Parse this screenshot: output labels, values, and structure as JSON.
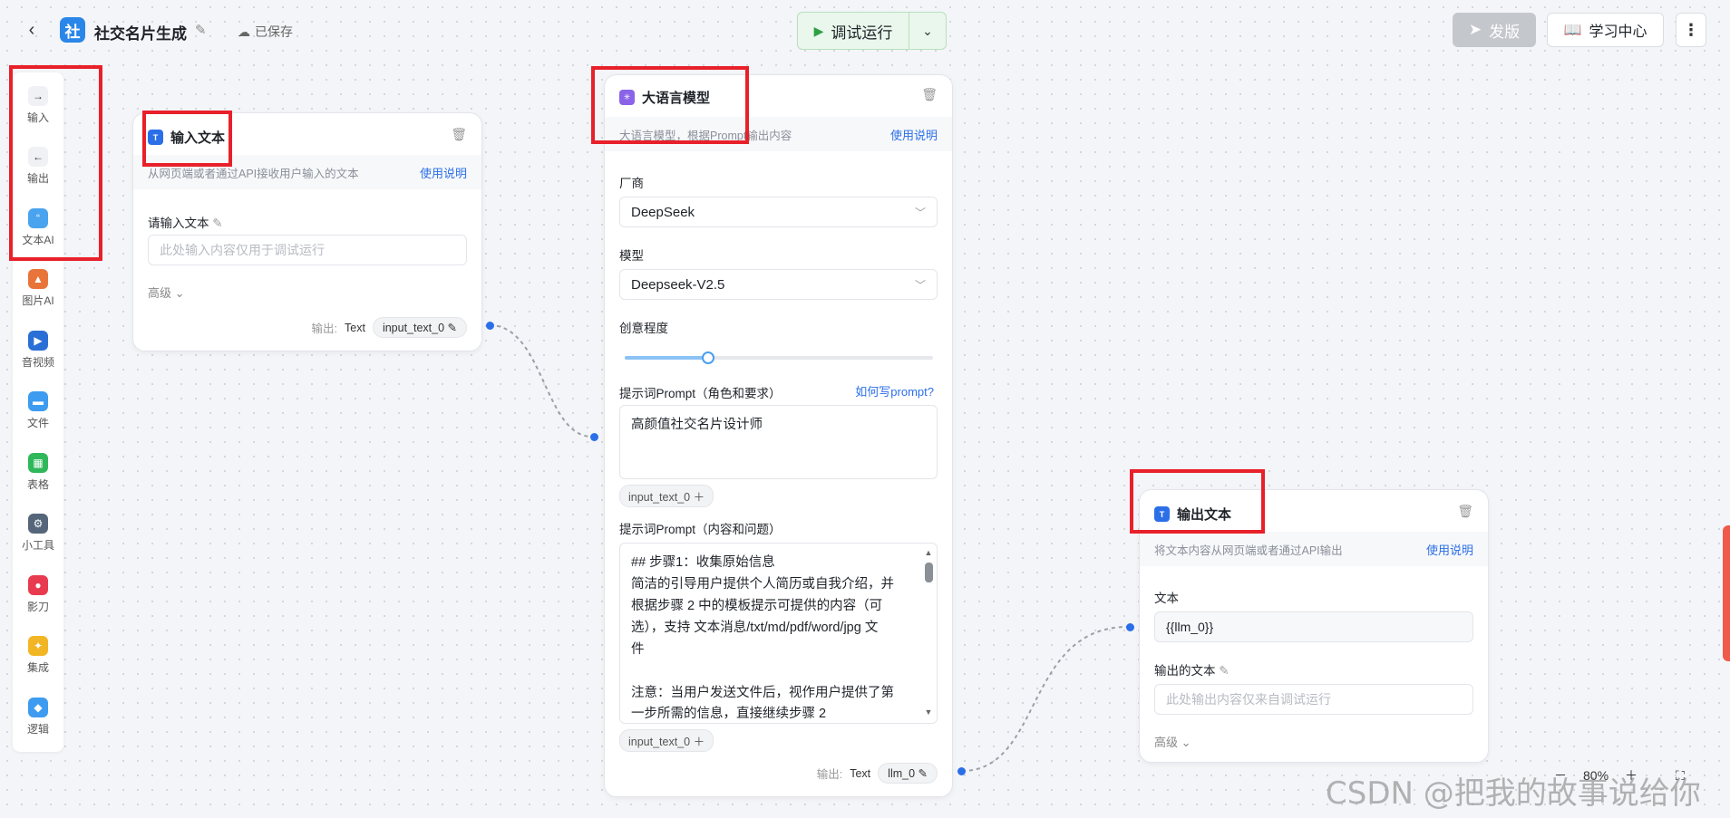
{
  "header": {
    "app_logo_char": "社",
    "title": "社交名片生成",
    "saved_label": "已保存",
    "run_label": "调试运行",
    "publish_label": "发版",
    "learn_label": "学习中心"
  },
  "sidebar": {
    "items": [
      {
        "label": "输入",
        "icon": "arrow-right-icon",
        "color": "#f0f1f4"
      },
      {
        "label": "输出",
        "icon": "arrow-left-icon",
        "color": "#f0f1f4"
      },
      {
        "label": "文本AI",
        "icon": "quote-icon",
        "color": "#4aa3ef"
      },
      {
        "label": "图片AI",
        "icon": "image-icon",
        "color": "#e9743a"
      },
      {
        "label": "音视频",
        "icon": "video-icon",
        "color": "#2a6fd6"
      },
      {
        "label": "文件",
        "icon": "folder-icon",
        "color": "#3d9bf0"
      },
      {
        "label": "表格",
        "icon": "table-icon",
        "color": "#2fb85a"
      },
      {
        "label": "小工具",
        "icon": "gear-icon",
        "color": "#55667a"
      },
      {
        "label": "影刀",
        "icon": "shadow-knife-icon",
        "color": "#e83b4f"
      },
      {
        "label": "集成",
        "icon": "puzzle-icon",
        "color": "#f2b523"
      },
      {
        "label": "逻辑",
        "icon": "logic-icon",
        "color": "#3d9bf0"
      }
    ]
  },
  "input_node": {
    "title": "输入文本",
    "desc": "从网页端或者通过API接收用户输入的文本",
    "help": "使用说明",
    "field_label": "请输入文本",
    "placeholder": "此处输入内容仅用于调试运行",
    "advanced": "高级",
    "out_label": "输出:",
    "out_type": "Text",
    "out_var": "input_text_0"
  },
  "llm_node": {
    "title": "大语言模型",
    "desc": "大语言模型，根据Prompt输出内容",
    "help": "使用说明",
    "vendor_label": "厂商",
    "vendor_value": "DeepSeek",
    "model_label": "模型",
    "model_value": "Deepseek-V2.5",
    "creativity_label": "创意程度",
    "creativity_level": 0.27,
    "prompt1_label": "提示词Prompt（角色和要求）",
    "prompt_help": "如何写prompt?",
    "prompt1_value": "高颜值社交名片设计师",
    "var_chip": "input_text_0",
    "prompt2_label": "提示词Prompt（内容和问题）",
    "prompt2_lines": [
      "## 步骤1：收集原始信息",
      "简洁的引导用户提供个人简历或自我介绍，并",
      "根据步骤 2 中的模板提示可提供的内容（可",
      "选），支持 文本消息/txt/md/pdf/word/jpg 文",
      "件",
      "",
      "注意：当用户发送文件后，视作用户提供了第",
      "一步所需的信息，直接继续步骤 2"
    ],
    "out_label": "输出:",
    "out_type": "Text",
    "out_var": "llm_0"
  },
  "output_node": {
    "title": "输出文本",
    "desc": "将文本内容从网页端或者通过API输出",
    "help": "使用说明",
    "text_label": "文本",
    "text_value": "{{llm_0}}",
    "out_label": "输出的文本",
    "placeholder": "此处输出内容仅来自调试运行",
    "advanced": "高级"
  },
  "zoom": {
    "value": "80%"
  },
  "watermark": "CSDN @把我的故事说给你",
  "colors": {
    "accent": "#2b6fe8",
    "highlight": "#e8202a",
    "run_bg": "#eaf7ec"
  }
}
